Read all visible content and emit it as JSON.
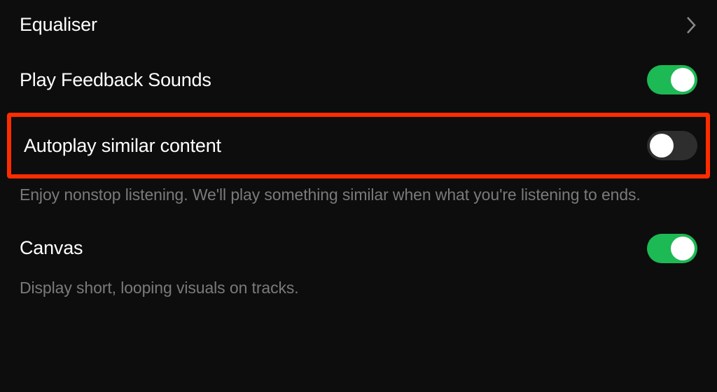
{
  "settings": {
    "equaliser": {
      "label": "Equaliser"
    },
    "playFeedback": {
      "label": "Play Feedback Sounds",
      "enabled": true
    },
    "autoplay": {
      "label": "Autoplay similar content",
      "enabled": false,
      "description": "Enjoy nonstop listening. We'll play something similar when what you're listening to ends."
    },
    "canvas": {
      "label": "Canvas",
      "enabled": true,
      "description": "Display short, looping visuals on tracks."
    }
  },
  "colors": {
    "background": "#0d0d0d",
    "text": "#ffffff",
    "secondaryText": "#7a7a7a",
    "accent": "#1db954",
    "highlight": "#ff2c00",
    "toggleOff": "#2e2e2e"
  }
}
